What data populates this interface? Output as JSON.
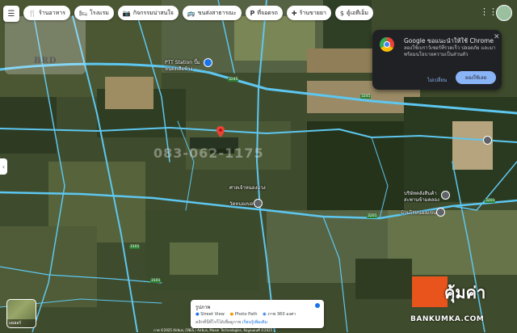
{
  "toolbar": {
    "chips": [
      {
        "icon": "restaurant-icon",
        "label": "ร้านอาหาร"
      },
      {
        "icon": "bed-icon",
        "label": "โรงแรม"
      },
      {
        "icon": "camera-icon",
        "label": "กิจกรรมน่าสนใจ"
      },
      {
        "icon": "bus-icon",
        "label": "ขนส่งสาธารณะ"
      },
      {
        "icon": "parking-icon",
        "label": "ที่จอดรถ"
      },
      {
        "icon": "pharmacy-icon",
        "label": "ร้านขายยา"
      },
      {
        "icon": "atm-icon",
        "label": "ตู้เอทีเอ็ม"
      }
    ]
  },
  "popup": {
    "title": "Google ขอแนะนำให้ใช้ Chrome",
    "body": "ลองใช้เบราว์เซอร์ที่รวดเร็ว ปลอดภัย และมาพร้อมนโยบายความเป็นส่วนตัว",
    "no_label": "ไม่เปลี่ยน",
    "yes_label": "ลองใช้เลย"
  },
  "brd_logo": "BRD",
  "places": {
    "ptt": "PTT Station ปั๊ม",
    "ptt2": "หนองเสือช้าง",
    "mid": "ศาลเจ้าหนองม่วง",
    "temple": "วัดหนองบอน",
    "right1": "บริษัทคลังสินค้า",
    "right2": "สะพานข้ามคลอง",
    "right3": "บ้านไร่หนองแขนา"
  },
  "road_numbers": [
    "3245",
    "3245",
    "3201",
    "3201",
    "3101",
    "3101"
  ],
  "watermark": "083-062-1175",
  "layers": {
    "label": "เลเยอร์"
  },
  "photo_card": {
    "title": "รูปภาพ",
    "sv_label": "Street View",
    "pp_label": "Photo Path",
    "p360_label": "ภาพ 360 องศา",
    "hint": "คลิกที่นี่ที่ไรก็ได้เพื่อดูภาพ",
    "hint_link": "เรียนรู้เพิ่มเติม"
  },
  "attribution": "ภาพ ©2025 Airbus, CNES / Airbus, Maxar Technologies, ข้อมูลแผนที่ ©2025",
  "logo": {
    "name": "คุ้มค่า",
    "site": "BANKUMKA.COM"
  },
  "colors": {
    "road": "#5ec7f0",
    "satellite": "#3d4a2c",
    "popup_bg": "#202124",
    "accent": "#8ab4f8",
    "logo_orange": "#e8541c"
  }
}
